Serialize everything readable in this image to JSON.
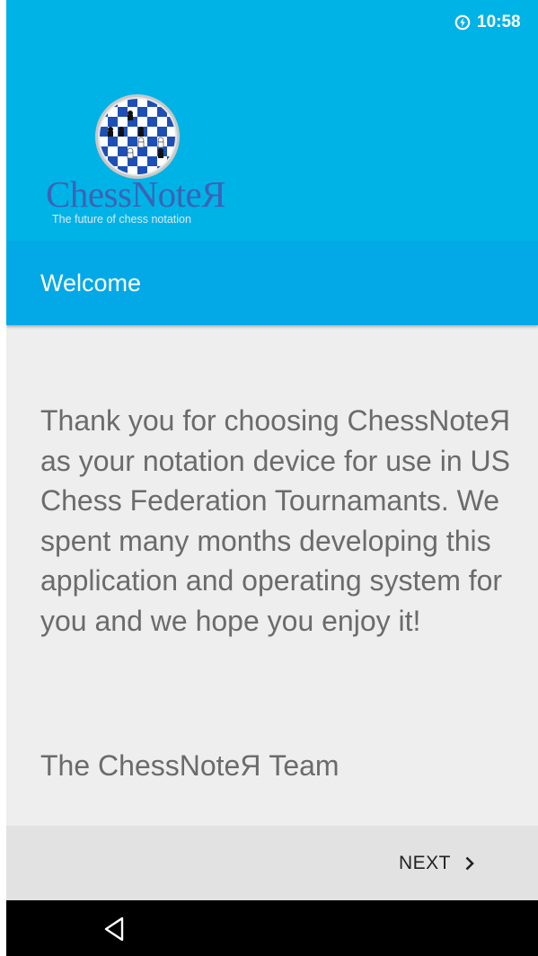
{
  "status_bar": {
    "time": "10:58",
    "icon": "data-saver-icon"
  },
  "logo": {
    "name": "ChessNoteЯ",
    "tagline": "The future of chess notation",
    "icon": "chessboard-logo-icon"
  },
  "header": {
    "title": "Welcome"
  },
  "body": {
    "message": "Thank you for choosing ChessNoteЯ as your notation device for use in US Chess Federation Tournamants. We spent many months developing this application and operating system for you and we hope you enjoy it!",
    "signature": "The ChessNoteЯ Team"
  },
  "footer": {
    "next_label": "NEXT",
    "next_icon": "chevron-right-icon"
  },
  "nav_bar": {
    "back_icon": "back-triangle-icon"
  },
  "colors": {
    "header_bg": "#00b3e6",
    "titlebar_bg": "#03a9e7",
    "body_bg": "#eeeeee",
    "footer_bg": "#e2e2e2",
    "navbar_bg": "#000000",
    "logo_text": "#3c63b6"
  }
}
